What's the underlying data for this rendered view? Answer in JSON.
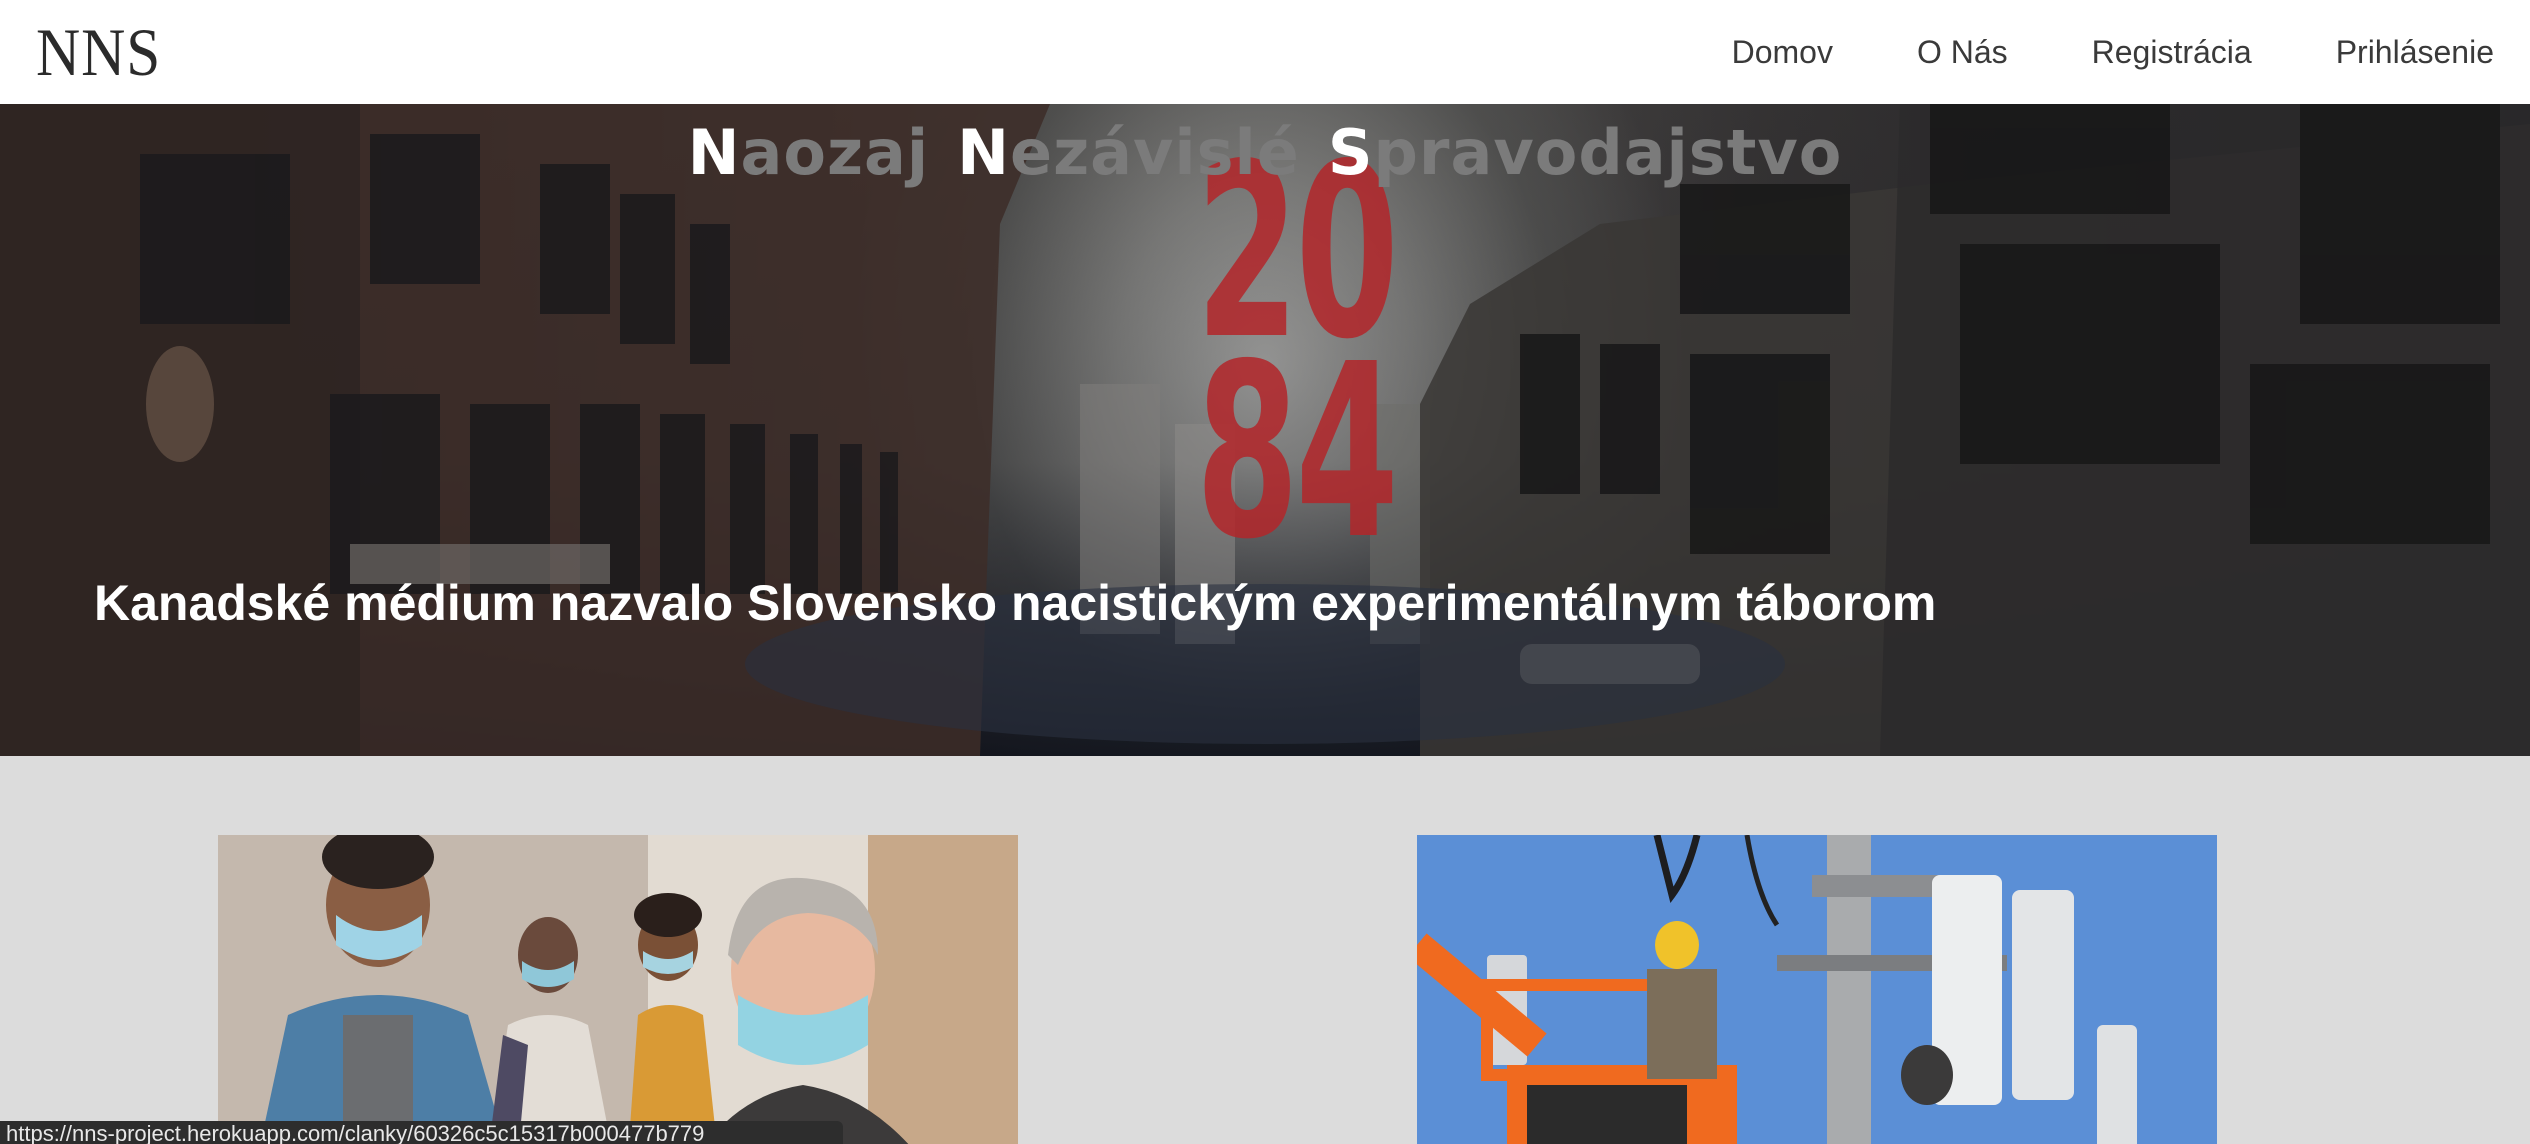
{
  "header": {
    "logo": "NNS",
    "nav": [
      {
        "label": "Domov"
      },
      {
        "label": "O Nás"
      },
      {
        "label": "Registrácia"
      },
      {
        "label": "Prihlásenie"
      }
    ]
  },
  "hero": {
    "tagline": [
      {
        "cap": "N",
        "rest": "aozaj"
      },
      {
        "cap": "N",
        "rest": "ezávislé"
      },
      {
        "cap": "S",
        "rest": "pravodajstvo"
      }
    ],
    "year_top": "20",
    "year_bottom": "84",
    "headline": "Kanadské médium nazvalo Slovensko nacistickým experimentálnym táborom"
  },
  "articles": [
    {
      "image": "people-in-face-masks-photo"
    },
    {
      "image": "5g-antenna-worker-photo"
    }
  ],
  "status_bar": {
    "url": "https://nns-project.herokuapp.com/clanky/60326c5c15317b000477b779"
  },
  "colors": {
    "accent_red": "#b3262a",
    "page_background": "#dcdcdc",
    "nav_text": "#3a3a3a"
  }
}
